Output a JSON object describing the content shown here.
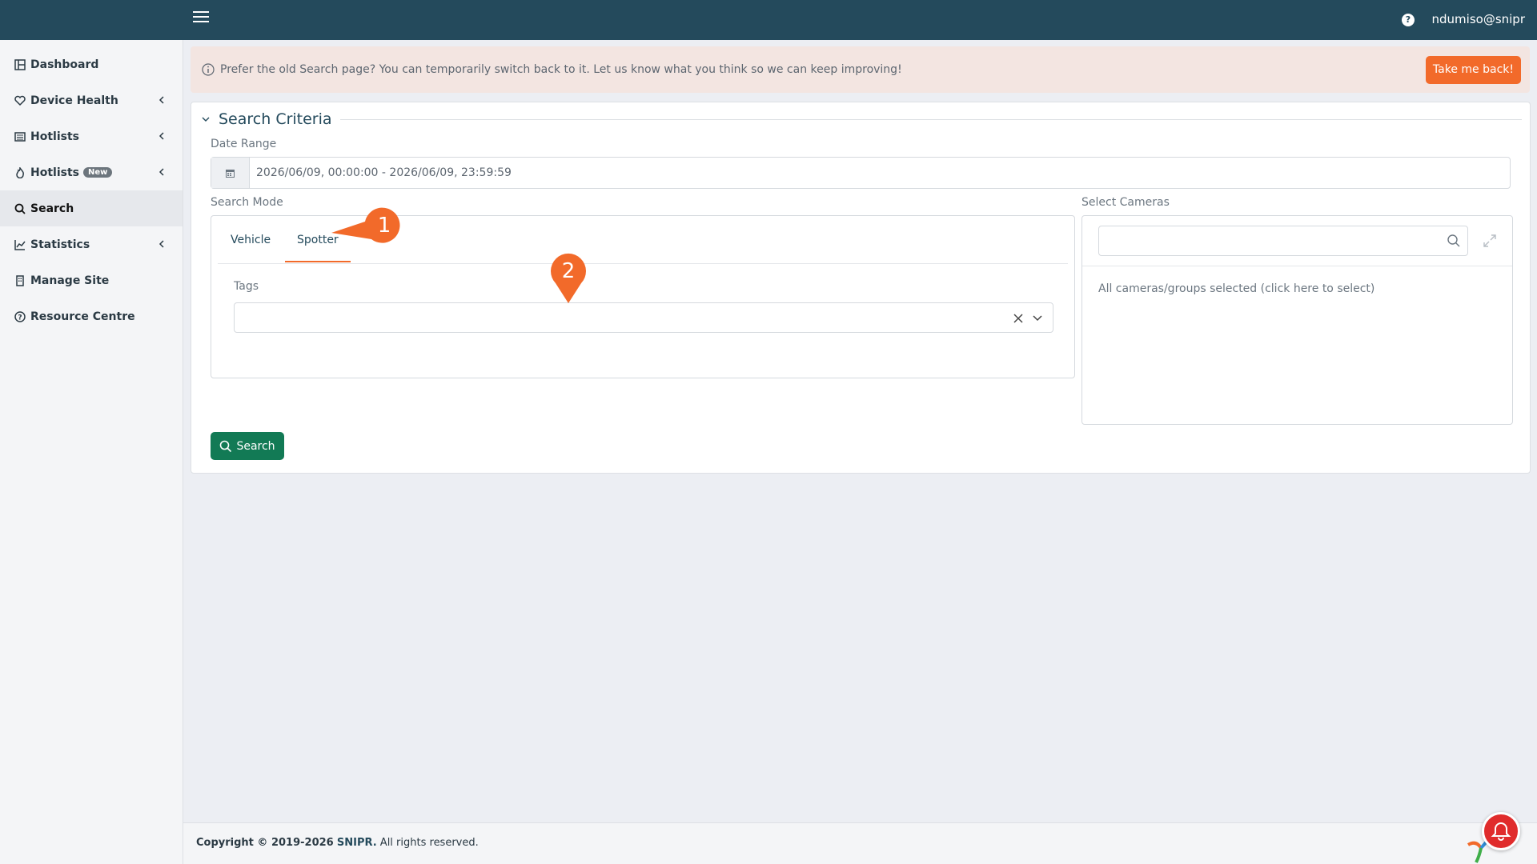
{
  "header": {
    "user": "ndumiso@snipr"
  },
  "sidebar": {
    "items": [
      {
        "label": "Dashboard",
        "icon": "dashboard-icon"
      },
      {
        "label": "Device Health",
        "icon": "heart-icon"
      },
      {
        "label": "Hotlists",
        "icon": "list-icon"
      },
      {
        "label": "Hotlists",
        "badge": "New",
        "icon": "fire-icon"
      },
      {
        "label": "Search",
        "icon": "search-icon"
      },
      {
        "label": "Statistics",
        "icon": "chart-icon"
      },
      {
        "label": "Manage Site",
        "icon": "building-icon"
      },
      {
        "label": "Resource Centre",
        "icon": "question-icon"
      }
    ],
    "active": "Search"
  },
  "alert": {
    "text": "Prefer the old Search page? You can temporarily switch back to it. Let us know what you think so we can keep improving!",
    "button": "Take me back!"
  },
  "criteria": {
    "title": "Search Criteria",
    "date_range_label": "Date Range",
    "date_range_value": "2026/06/09, 00:00:00 - 2026/06/09, 23:59:59",
    "search_mode_label": "Search Mode",
    "tabs": [
      "Vehicle",
      "Spotter"
    ],
    "active_tab": "Spotter",
    "tags_label": "Tags",
    "tags_value": "",
    "cameras_label": "Select Cameras",
    "cameras_search_value": "",
    "cameras_note": "All cameras/groups selected (click here to select)",
    "search_button": "Search"
  },
  "footer": {
    "copyright_prefix": "Copyright © 2019-2026",
    "brand": "SNIPR.",
    "suffix": " All rights reserved."
  },
  "callouts": [
    "1",
    "2"
  ],
  "colors": {
    "topbar": "#244a5c",
    "accent_orange": "#f26a2a",
    "search_green": "#127a55",
    "alert_bg": "#f3e5e1",
    "notification_red": "#e02c2c"
  }
}
